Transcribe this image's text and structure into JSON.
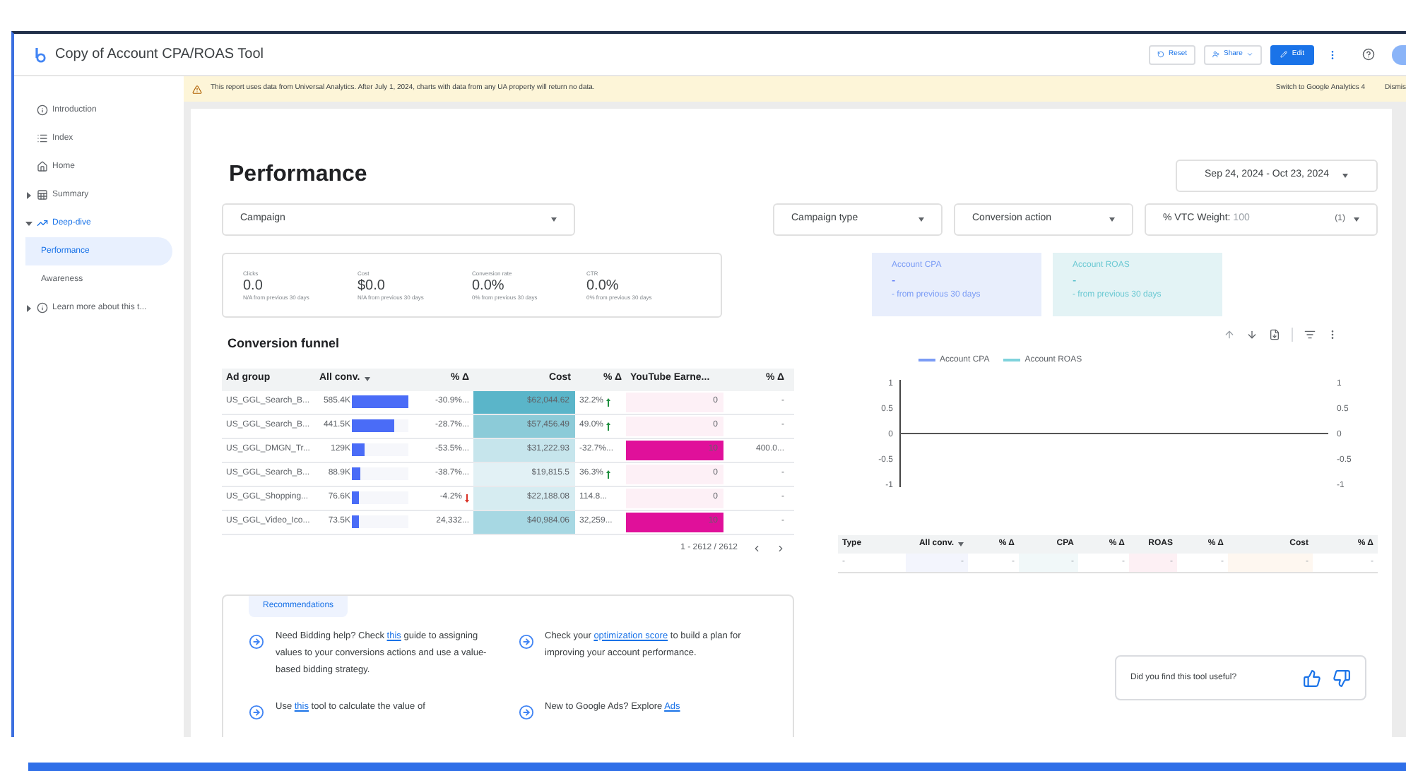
{
  "header": {
    "title": "Copy of Account CPA/ROAS Tool",
    "buttons": [
      {
        "kind": "reset",
        "label": "Reset"
      },
      {
        "kind": "share",
        "label": "Share"
      },
      {
        "kind": "edit",
        "label": "Edit"
      }
    ]
  },
  "banner": {
    "text": "This report uses data from Universal Analytics. After July 1, 2024, charts with data from any UA property will return no data.",
    "action": "Switch to Google Analytics 4",
    "dismiss": "Dismis"
  },
  "sidebar": {
    "items": [
      {
        "label": "Introduction",
        "kind": "page",
        "selected": false
      },
      {
        "label": "Index",
        "kind": "page",
        "selected": false
      },
      {
        "label": "Home",
        "kind": "page",
        "selected": false
      },
      {
        "label": "Summary",
        "kind": "group",
        "expanded": false,
        "selected": false
      },
      {
        "label": "Deep-dive",
        "kind": "group",
        "expanded": true,
        "selected": false,
        "children": [
          {
            "label": "Performance",
            "selected": true
          },
          {
            "label": "Awareness",
            "selected": false
          }
        ]
      },
      {
        "label": "Learn more about this t...",
        "kind": "group",
        "expanded": false,
        "selected": false
      }
    ]
  },
  "page_title": "Performance",
  "date_range": "Sep 24, 2024 - Oct 23, 2024",
  "filters": [
    {
      "label": "Campaign"
    },
    {
      "label": "Campaign type"
    },
    {
      "label": "Conversion action"
    },
    {
      "label": "% VTC Weight:",
      "value": "100",
      "count": "(1)"
    }
  ],
  "scorecards": [
    {
      "label": "Clicks",
      "value": "0.0",
      "note": "N/A from previous 30 days"
    },
    {
      "label": "Cost",
      "value": "$0.0",
      "note": "N/A from previous 30 days"
    },
    {
      "label": "Conversion rate",
      "value": "0.0%",
      "note": "0% from previous 30 days"
    },
    {
      "label": "CTR",
      "value": "0.0%",
      "note": "0% from previous 30 days"
    }
  ],
  "kpi_cards": [
    {
      "label": "Account CPA",
      "value": "-",
      "note": "- from previous 30 days",
      "color": "#e8eefc"
    },
    {
      "label": "Account ROAS",
      "value": "-",
      "note": "- from previous 30 days",
      "color": "#e3f3f5"
    }
  ],
  "funnel": {
    "title": "Conversion funnel",
    "columns": [
      {
        "label": "Ad group",
        "sorted": false
      },
      {
        "label": "All conv.",
        "sorted": true
      },
      {
        "label": "% Δ",
        "sorted": false
      },
      {
        "label": "Cost",
        "sorted": false
      },
      {
        "label": "% Δ",
        "sorted": false
      },
      {
        "label": "YouTube Earne...",
        "sorted": false
      },
      {
        "label": "% Δ",
        "sorted": false
      }
    ],
    "rows": [
      {
        "ad_group": "US_GGL_Search_B...",
        "all_conv": {
          "text": "585.4K",
          "level": 1
        },
        "all_conv_delta": {
          "text": "-30.9%...",
          "up": false,
          "down": false
        },
        "cost": {
          "text": "$62,044.62",
          "color": "#5ab5c9"
        },
        "cost_delta": {
          "text": "32.2%",
          "up": true,
          "down": false
        },
        "youtube": {
          "text": "0",
          "color": "#fdf0f6"
        },
        "youtube_delta": "-"
      },
      {
        "ad_group": "US_GGL_Search_B...",
        "all_conv": {
          "text": "441.5K",
          "level": 0.75
        },
        "all_conv_delta": {
          "text": "-28.7%...",
          "up": false,
          "down": false
        },
        "cost": {
          "text": "$57,456.49",
          "color": "#8ccbd8"
        },
        "cost_delta": {
          "text": "49.0%",
          "up": true,
          "down": false
        },
        "youtube": {
          "text": "0",
          "color": "#fdf0f6"
        },
        "youtube_delta": "-"
      },
      {
        "ad_group": "US_GGL_DMGN_Tr...",
        "all_conv": {
          "text": "129K",
          "level": 0.22
        },
        "all_conv_delta": {
          "text": "-53.5%...",
          "up": false,
          "down": false
        },
        "cost": {
          "text": "$31,222.93",
          "color": "#c6e5ec"
        },
        "cost_delta": {
          "text": "-32.7%...",
          "up": false,
          "down": false
        },
        "youtube": {
          "text": "10",
          "color": "#e0109a"
        },
        "youtube_delta": "400.0..."
      },
      {
        "ad_group": "US_GGL_Search_B...",
        "all_conv": {
          "text": "88.9K",
          "level": 0.15
        },
        "all_conv_delta": {
          "text": "-38.7%...",
          "up": false,
          "down": false
        },
        "cost": {
          "text": "$19,815.5",
          "color": "#e2f1f5"
        },
        "cost_delta": {
          "text": "36.3%",
          "up": true,
          "down": false
        },
        "youtube": {
          "text": "0",
          "color": "#fdf0f6"
        },
        "youtube_delta": "-"
      },
      {
        "ad_group": "US_GGL_Shopping...",
        "all_conv": {
          "text": "76.6K",
          "level": 0.13
        },
        "all_conv_delta": {
          "text": "-4.2%",
          "up": false,
          "down": true
        },
        "cost": {
          "text": "$22,188.08",
          "color": "#d6ecf1"
        },
        "cost_delta": {
          "text": "114.8...",
          "up": false,
          "down": false
        },
        "youtube": {
          "text": "0",
          "color": "#fdf0f6"
        },
        "youtube_delta": "-"
      },
      {
        "ad_group": "US_GGL_Video_Ico...",
        "all_conv": {
          "text": "73.5K",
          "level": 0.12
        },
        "all_conv_delta": {
          "text": "24,332...",
          "up": false,
          "down": false
        },
        "cost": {
          "text": "$40,984.06",
          "color": "#a7d8e3"
        },
        "cost_delta": {
          "text": "32,259...",
          "up": false,
          "down": false
        },
        "youtube": {
          "text": "10",
          "color": "#e0109a"
        },
        "youtube_delta": "-"
      }
    ],
    "pagination": "1 - 2612 / 2612"
  },
  "chart": {
    "legend": [
      {
        "name": "Account CPA",
        "color": "#7b9cf5"
      },
      {
        "name": "Account ROAS",
        "color": "#7fd3dc"
      }
    ],
    "left_ticks": [
      "1",
      "0.5",
      "0",
      "-0.5",
      "-1"
    ],
    "right_ticks": [
      "1",
      "0.5",
      "0",
      "-0.5",
      "-1"
    ]
  },
  "type_table": {
    "columns": [
      {
        "label": "Type",
        "sorted": false
      },
      {
        "label": "All conv.",
        "sorted": true
      },
      {
        "label": "% Δ",
        "sorted": false
      },
      {
        "label": "CPA",
        "sorted": false
      },
      {
        "label": "% Δ",
        "sorted": false
      },
      {
        "label": "ROAS",
        "sorted": false
      },
      {
        "label": "% Δ",
        "sorted": false
      },
      {
        "label": "Cost",
        "sorted": false
      },
      {
        "label": "% Δ",
        "sorted": false
      }
    ],
    "row": [
      {
        "text": "-",
        "color": "#ffffff"
      },
      {
        "text": "-",
        "color": "#f3f5fd"
      },
      {
        "text": "-",
        "color": "#ffffff"
      },
      {
        "text": "-",
        "color": "#f1f8f9"
      },
      {
        "text": "-",
        "color": "#ffffff"
      },
      {
        "text": "-",
        "color": "#fdf0f4"
      },
      {
        "text": "-",
        "color": "#ffffff"
      },
      {
        "text": "-",
        "color": "#fef7f0"
      },
      {
        "text": "-",
        "color": "#ffffff"
      }
    ]
  },
  "recommendations": {
    "title": "Recommendations",
    "items": [
      {
        "before": "Need Bidding help? Check ",
        "link": "this",
        "after": " guide to assigning values to your conversions actions and use a value-based bidding strategy."
      },
      {
        "before": "Check your ",
        "link": "optimization score",
        "after": " to build a plan for improving your account performance."
      },
      {
        "before": "Use ",
        "link": "this",
        "after": " tool to calculate the value of"
      },
      {
        "before": "New to Google Ads? Explore ",
        "link": "Ads"
      }
    ]
  },
  "feedback": {
    "question": "Did you find this tool useful?"
  }
}
